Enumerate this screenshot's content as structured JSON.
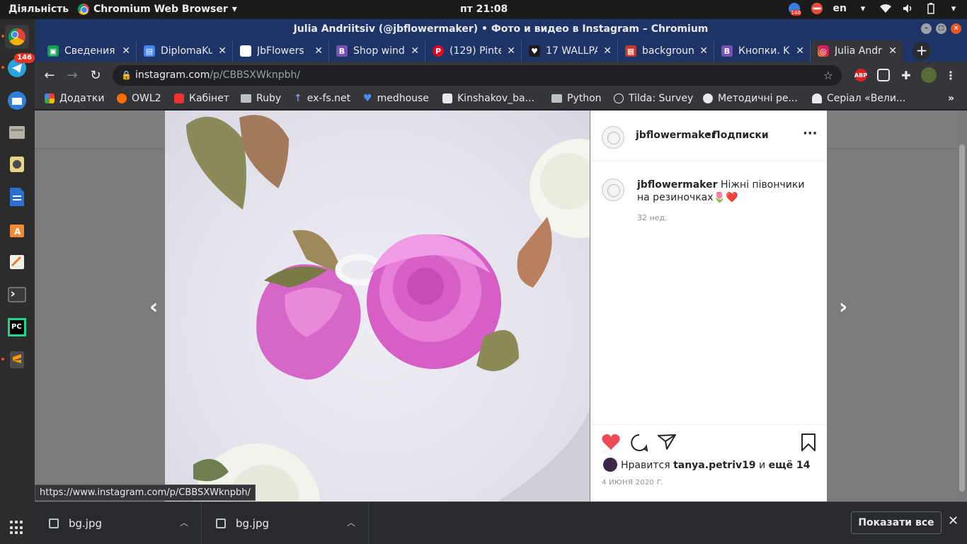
{
  "topbar": {
    "activities": "Діяльність",
    "app_menu": "Chromium Web Browser",
    "clock": "пт 21:08",
    "badge": "146",
    "lang": "en"
  },
  "dock": {
    "telegram_badge": "146"
  },
  "window": {
    "title": "Julia Andriitsiv (@jbflowermaker) • Фото и видео в Instagram – Chromium"
  },
  "tabs": [
    {
      "label": "Сведения",
      "icon": "google-classroom-icon",
      "color": "#0f9d58"
    },
    {
      "label": "DiplomaKu",
      "icon": "doc-icon",
      "color": "#4285f4"
    },
    {
      "label": "JbFlowers",
      "icon": "blank-page-icon",
      "color": "#ffffff"
    },
    {
      "label": "Shop wind",
      "icon": "bootstrap-icon",
      "color": "#7952b3"
    },
    {
      "label": "(129) Pinte",
      "icon": "pinterest-icon",
      "color": "#e60023"
    },
    {
      "label": "17 WALLPA",
      "icon": "heart-icon",
      "color": "#1a1a1a"
    },
    {
      "label": "backgroun",
      "icon": "image-icon",
      "color": "#c0392b"
    },
    {
      "label": "Кнопки. K",
      "icon": "bootstrap-icon",
      "color": "#7952b3"
    },
    {
      "label": "Julia Andr",
      "icon": "instagram-icon",
      "color": "#d6249f"
    }
  ],
  "omnibox": {
    "host": "instagram.com",
    "path": "/p/CBBSXWknpbh/"
  },
  "extensions": {
    "abp": "ABP"
  },
  "bookmarks": [
    {
      "label": "Додатки",
      "icon": "apps-icon"
    },
    {
      "label": "OWL2",
      "icon": "owl-icon"
    },
    {
      "label": "Кабінет",
      "icon": "cabinet-icon"
    },
    {
      "label": "Ruby",
      "icon": "folder-icon"
    },
    {
      "label": "ex-fs.net",
      "icon": "arrow-up-icon"
    },
    {
      "label": "medhouse",
      "icon": "heart-icon"
    },
    {
      "label": "Kinshakov_ba...",
      "icon": "d-icon"
    },
    {
      "label": "Python",
      "icon": "folder-icon"
    },
    {
      "label": "Tilda: Survey",
      "icon": "tilda-icon"
    },
    {
      "label": "Методичні ре...",
      "icon": "globe-icon"
    },
    {
      "label": "Серіал «Вели...",
      "icon": "hat-icon"
    }
  ],
  "post": {
    "username": "jbflowermaker",
    "dot": "•",
    "follow": "Подписки",
    "caption_user": "jbflowermaker",
    "caption_text": "Ніжні півончики на резиночках🌷❤️",
    "caption_time": "32 нед.",
    "likes_prefix": "Нравится",
    "likes_user": "tanya.petriv19",
    "likes_and": "и",
    "likes_more": "ещё 14",
    "date": "4 ИЮНЯ 2020 Г.",
    "colors": {
      "heart": "#ed4956",
      "text": "#262626",
      "muted": "#8e8e8e"
    }
  },
  "status_url": "https://www.instagram.com/p/CBBSXWknpbh/",
  "downloads": {
    "items": [
      {
        "name": "bg.jpg"
      },
      {
        "name": "bg.jpg"
      }
    ],
    "show_all": "Показати все"
  }
}
